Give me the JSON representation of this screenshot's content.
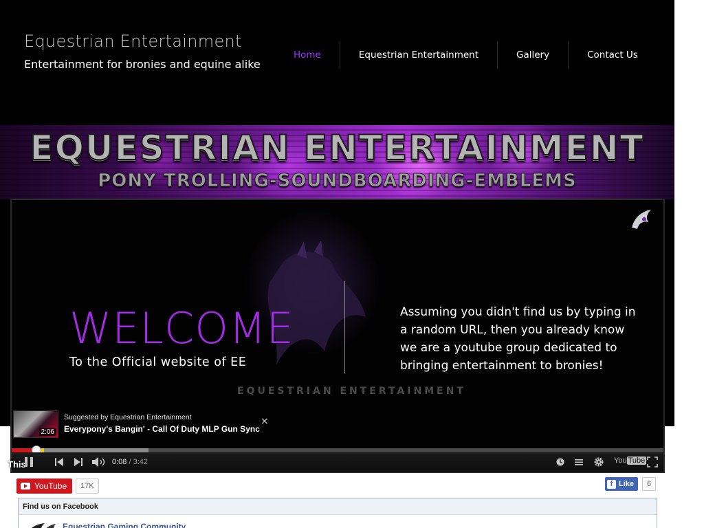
{
  "site": {
    "title": "Equestrian Entertainment",
    "tagline": "Entertainment for bronies and equine alike"
  },
  "nav": {
    "items": [
      {
        "label": "Home",
        "active": true
      },
      {
        "label": "Equestrian Entertainment",
        "active": false
      },
      {
        "label": "Gallery",
        "active": false
      },
      {
        "label": "Contact Us",
        "active": false
      }
    ]
  },
  "banner": {
    "title": "EQUESTRIAN ENTERTAINMENT",
    "subtitle": "PONY TROLLING-SOUNDBOARDING-EMBLEMS"
  },
  "video": {
    "welcome": "WELCOME",
    "welcome_sub": "To the Official website of EE",
    "intro": "Assuming you didn't find us by typing in a random URL, then you already know we are a youtube group dedicated to bringing entertainment to bronies!",
    "watermark": "EQUESTRIAN ENTERTAINMENT",
    "suggestion": {
      "by": "Suggested by Equestrian Entertainment",
      "title": "Everypony's Bangin' - Call Of Duty MLP Gun Sync",
      "duration": "2:06",
      "close": "×"
    },
    "player": {
      "current_time": "0:08",
      "duration": " / 3:42",
      "progress_played_fraction": 0.038,
      "progress_buffered_fraction": 0.21,
      "yt_logo_you": "You",
      "yt_logo_tube": "Tube"
    }
  },
  "overlay_text": "This",
  "youtube_subscribe": {
    "label": "YouTube",
    "count": "17K"
  },
  "facebook_like": {
    "label": "Like",
    "icon": "f",
    "count": "6"
  },
  "facebook_box": {
    "header": "Find us on Facebook",
    "page_name": "Equestrian Gaming Community"
  },
  "colors": {
    "accent": "#9c30ff",
    "welcome": "#a52be8",
    "youtube_red": "#cc181e",
    "facebook_blue": "#4267b2"
  }
}
